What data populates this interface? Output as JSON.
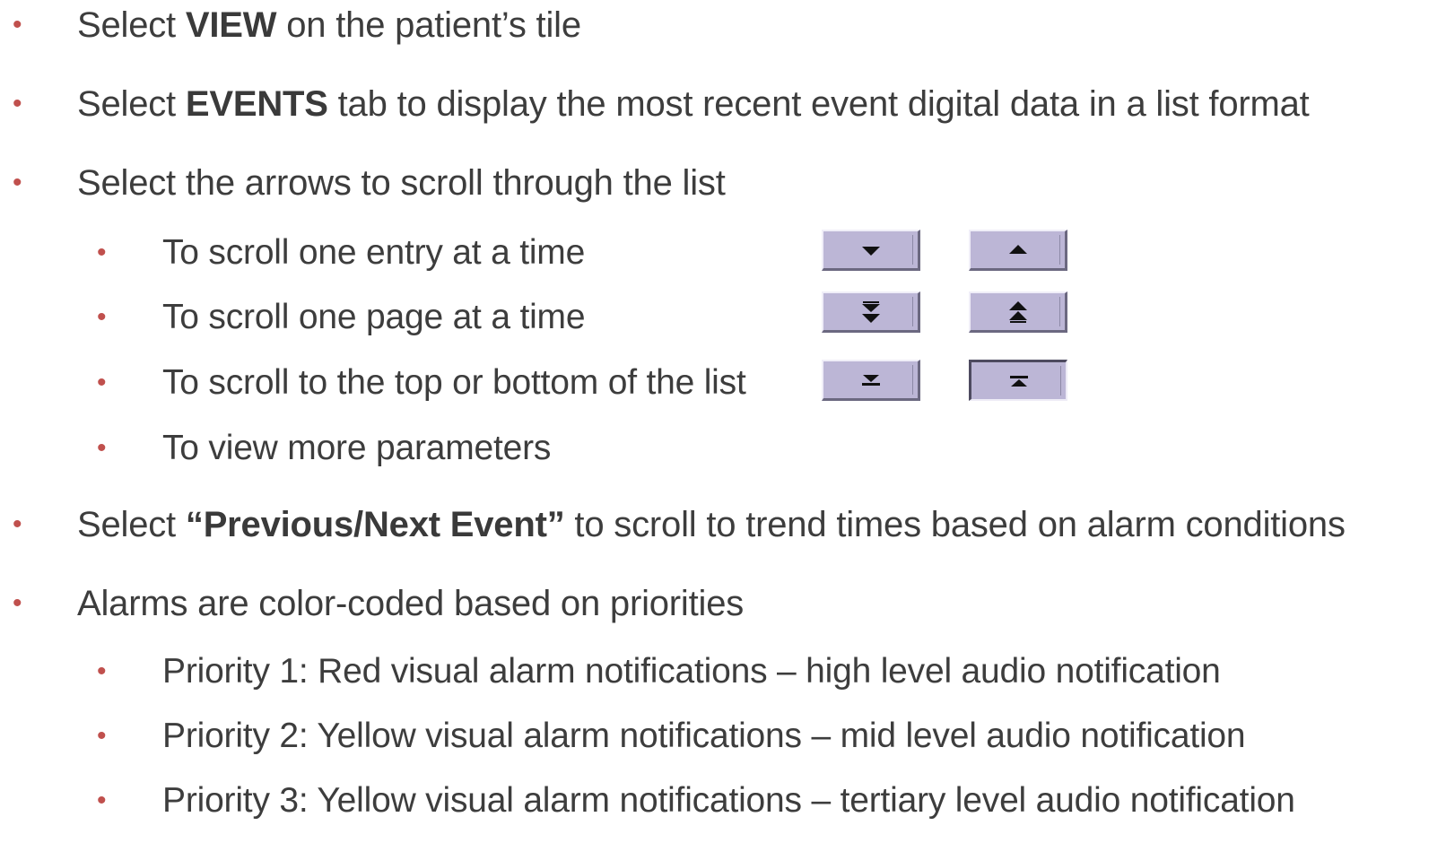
{
  "bullets": {
    "main_bullet_glyph": "•",
    "sub_bullet_glyph": "•",
    "bullet_color": "#c0504d"
  },
  "items": [
    {
      "prefix": "Select ",
      "bold": "VIEW",
      "suffix": " on the patient’s tile"
    },
    {
      "prefix": "Select ",
      "bold": "EVENTS",
      "suffix": " tab to display the most recent event digital data in a list format"
    },
    {
      "text": "Select the arrows to scroll through the list"
    },
    {
      "text": "To scroll one entry at a time"
    },
    {
      "text": "To scroll one page at a time"
    },
    {
      "text": "To scroll to the top or bottom of the list"
    },
    {
      "text": "To view more parameters"
    },
    {
      "prefix": "Select ",
      "bold": "“Previous/Next Event”",
      "suffix": " to scroll to trend times based on alarm conditions"
    },
    {
      "text": "Alarms are color-coded based on priorities"
    },
    {
      "text": "Priority 1: Red visual alarm notifications – high level audio notification"
    },
    {
      "text": "Priority 2: Yellow visual alarm notifications – mid level audio notification"
    },
    {
      "text": "Priority 3: Yellow visual alarm notifications – tertiary level audio notification"
    }
  ],
  "scroll_buttons": {
    "button_color": "#bcb6d6",
    "icons": {
      "entry_down": "arrow-down-icon",
      "entry_up": "arrow-up-icon",
      "page_down": "double-arrow-down-icon",
      "page_up": "double-arrow-up-icon",
      "bottom": "arrow-to-bottom-icon",
      "top": "arrow-to-top-icon"
    }
  }
}
